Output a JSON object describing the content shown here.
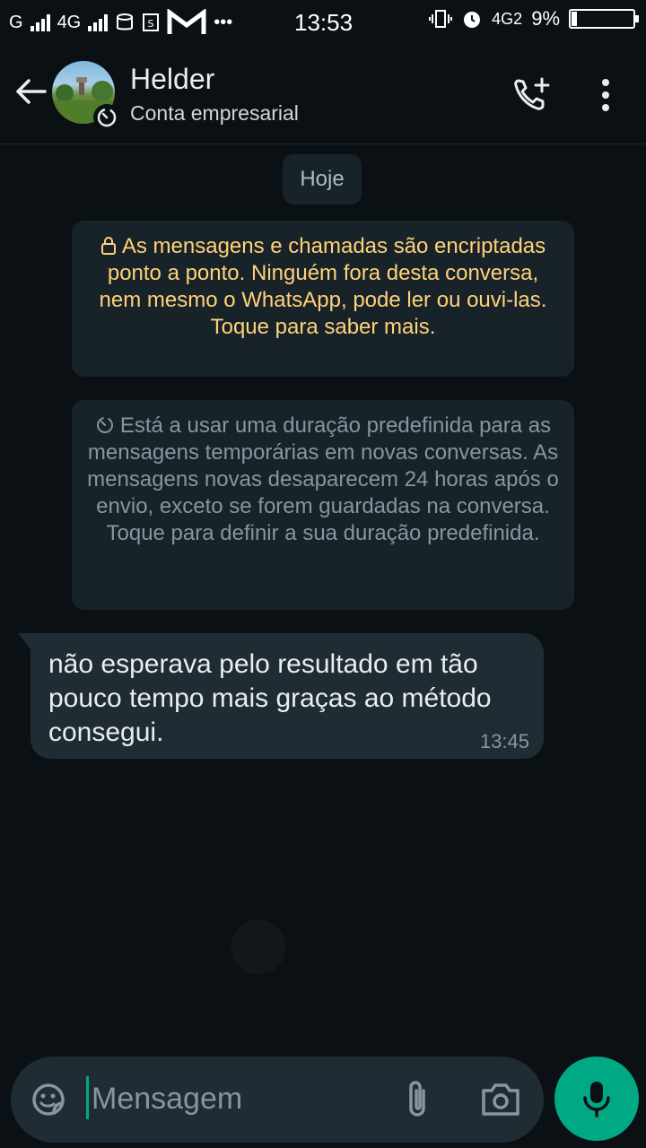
{
  "status_bar": {
    "left_labels": [
      "G",
      "4G"
    ],
    "time": "13:53",
    "network": "4G2",
    "battery": "9%",
    "battery_level": 0.09
  },
  "header": {
    "contact_name": "Helder",
    "contact_subtitle": "Conta empresarial"
  },
  "chat": {
    "date_chip": "Hoje",
    "encryption_notice": "As mensagens e chamadas são encriptadas ponto a ponto. Ninguém fora desta conversa, nem mesmo o WhatsApp, pode ler ou ouvi-las. Toque para saber mais.",
    "ephemeral_notice": "Está a usar uma duração predefinida para as mensagens temporárias em novas conversas. As mensagens novas desaparecem 24 horas após o envio, exceto se forem guardadas na conversa. Toque para definir a sua duração predefinida.",
    "messages": [
      {
        "text": "não esperava pelo resultado em tão pouco tempo mais graças ao método consegui.",
        "time": "13:45"
      }
    ]
  },
  "input": {
    "placeholder": "Mensagem"
  },
  "colors": {
    "accent": "#00a884",
    "notice_text": "#ffd279",
    "bubble_bg": "#1f2c34"
  }
}
